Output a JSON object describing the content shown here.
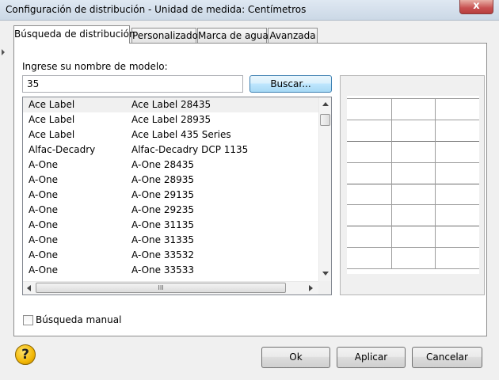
{
  "window": {
    "title": "Configuración de distribución - Unidad de medida: Centímetros",
    "close_glyph": "x"
  },
  "tabs": [
    {
      "label": "Búsqueda de distribución",
      "active": true
    },
    {
      "label": "Personalizado",
      "active": false
    },
    {
      "label": "Marca de agua",
      "active": false
    },
    {
      "label": "Avanzada",
      "active": false
    }
  ],
  "search": {
    "label": "Ingrese su nombre de modelo:",
    "value": "35",
    "button_label": "Buscar..."
  },
  "results": [
    {
      "brand": "Ace Label",
      "model": "Ace Label 28435",
      "selected": true
    },
    {
      "brand": "Ace Label",
      "model": "Ace Label 28935",
      "selected": false
    },
    {
      "brand": "Ace Label",
      "model": "Ace Label 435 Series",
      "selected": false
    },
    {
      "brand": "Alfac-Decadry",
      "model": "Alfac-Decadry DCP 1135",
      "selected": false
    },
    {
      "brand": "A-One",
      "model": "A-One 28435",
      "selected": false
    },
    {
      "brand": "A-One",
      "model": "A-One 28935",
      "selected": false
    },
    {
      "brand": "A-One",
      "model": "A-One 29135",
      "selected": false
    },
    {
      "brand": "A-One",
      "model": "A-One 29235",
      "selected": false
    },
    {
      "brand": "A-One",
      "model": "A-One 31135",
      "selected": false
    },
    {
      "brand": "A-One",
      "model": "A-One 31335",
      "selected": false
    },
    {
      "brand": "A-One",
      "model": "A-One 33532",
      "selected": false
    },
    {
      "brand": "A-One",
      "model": "A-One 33533",
      "selected": false
    }
  ],
  "scrollbar": {
    "thumb_grip": "III"
  },
  "preview": {
    "rows": 8,
    "columns": 3
  },
  "manual_search": {
    "label": "Búsqueda manual",
    "checked": false
  },
  "footer": {
    "help_glyph": "?",
    "ok_label": "Ok",
    "apply_label": "Aplicar",
    "cancel_label": "Cancelar"
  }
}
